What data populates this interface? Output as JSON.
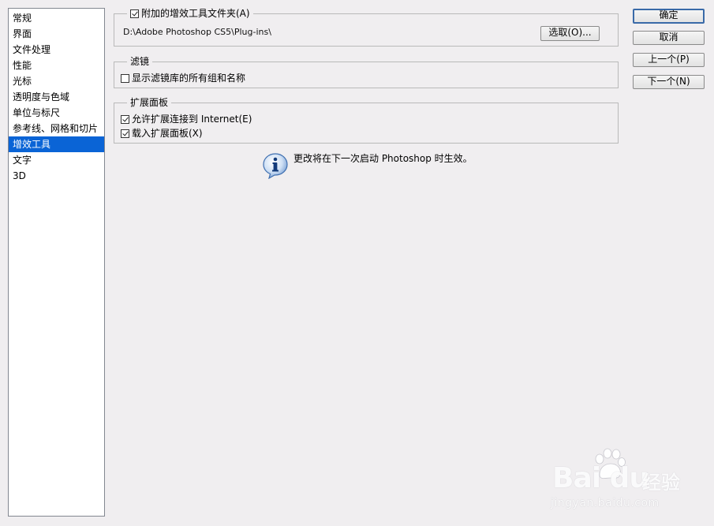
{
  "sidebar": {
    "items": [
      {
        "label": "常规"
      },
      {
        "label": "界面"
      },
      {
        "label": "文件处理"
      },
      {
        "label": "性能"
      },
      {
        "label": "光标"
      },
      {
        "label": "透明度与色域"
      },
      {
        "label": "单位与标尺"
      },
      {
        "label": "参考线、网格和切片"
      },
      {
        "label": "增效工具",
        "selected": true
      },
      {
        "label": "文字"
      },
      {
        "label": "3D"
      }
    ]
  },
  "plugins_group": {
    "checkbox_label": "附加的增效工具文件夹(A)",
    "checked": true,
    "path": "D:\\Adobe Photoshop CS5\\Plug-ins\\",
    "choose_button": "选取(O)..."
  },
  "filters_group": {
    "legend": "滤镜",
    "option_label": "显示滤镜库的所有组和名称",
    "option_checked": false
  },
  "extensions_group": {
    "legend": "扩展面板",
    "options": [
      {
        "label": "允许扩展连接到 Internet(E)",
        "checked": true
      },
      {
        "label": "载入扩展面板(X)",
        "checked": true
      }
    ]
  },
  "info_message": "更改将在下一次启动 Photoshop 时生效。",
  "buttons": {
    "ok": "确定",
    "cancel": "取消",
    "prev": "上一个(P)",
    "next": "下一个(N)"
  },
  "watermark": {
    "logo": "Bai du",
    "cn": "经验",
    "url": "jingyan.baidu.com"
  },
  "colors": {
    "background": "#f0eef0",
    "selection": "#0a64d6",
    "default_button_border": "#3a6aa8"
  }
}
